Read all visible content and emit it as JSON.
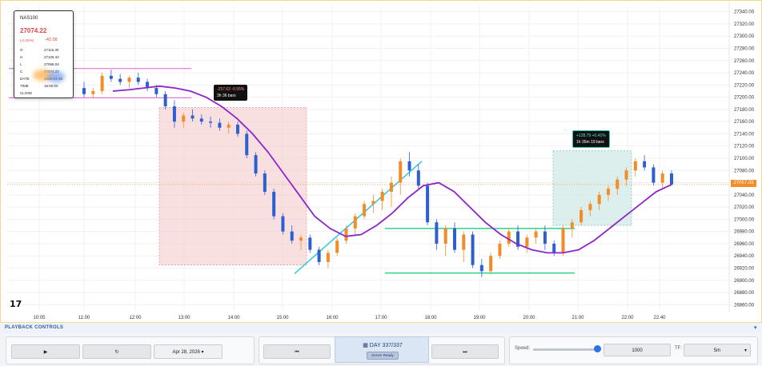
{
  "chart": {
    "symbol": "NAS100",
    "last_price": "27074.22",
    "change_pct": "(-0.16%)",
    "change_abs": "-42.08",
    "ohlc_rows": [
      {
        "k": "O",
        "v": "27116.30"
      },
      {
        "k": "H",
        "v": "27125.42"
      },
      {
        "k": "L",
        "v": "27068.04"
      },
      {
        "k": "C",
        "v": "27074.22"
      },
      {
        "k": "DATE",
        "v": "2026-04-28"
      },
      {
        "k": "TIME",
        "v": "16:50:00"
      },
      {
        "k": "CLOSE",
        "v": ""
      }
    ],
    "current_price_tag": "27057.03",
    "short_box_label": {
      "line1": "-257.63  -0.95%",
      "line2": "3h   36 bars"
    },
    "long_box_label": {
      "line1": "+128.79  +0.41%",
      "line2": "1h 35m   19 bars"
    },
    "logo_text": "17",
    "colors": {
      "up": "#f28c28",
      "down": "#2e5fd1",
      "ma": "#8e24c9",
      "trend": "#2ec6e0",
      "level": "#2ed38a",
      "short_box": "#f4c7c7",
      "long_box": "#cfe8e6",
      "range_line": "#e060d0"
    }
  },
  "chart_data": {
    "type": "candlestick",
    "x_ticks": [
      "10:05",
      "11:00",
      "12:00",
      "13:00",
      "14:00",
      "15:00",
      "16:00",
      "17:00",
      "18:00",
      "19:00",
      "20:00",
      "21:00",
      "22:00",
      "22:40"
    ],
    "y_ticks": [
      "27340.00",
      "27320.00",
      "27300.00",
      "27280.00",
      "27260.00",
      "27240.00",
      "27220.00",
      "27200.00",
      "27180.00",
      "27160.00",
      "27140.00",
      "27120.00",
      "27100.00",
      "27080.00",
      "27060.00",
      "27040.00",
      "27020.00",
      "27000.00",
      "26980.00",
      "26960.00",
      "26940.00",
      "26920.00",
      "26900.00",
      "26880.00",
      "26860.00"
    ],
    "ylim": [
      26850,
      27350
    ],
    "candles": [
      [
        27215,
        27225,
        27200,
        27205
      ],
      [
        27205,
        27215,
        27198,
        27210
      ],
      [
        27210,
        27240,
        27205,
        27235
      ],
      [
        27235,
        27245,
        27225,
        27230
      ],
      [
        27230,
        27238,
        27220,
        27225
      ],
      [
        27225,
        27235,
        27215,
        27232
      ],
      [
        27232,
        27240,
        27220,
        27225
      ],
      [
        27225,
        27230,
        27210,
        27215
      ],
      [
        27215,
        27220,
        27200,
        27205
      ],
      [
        27205,
        27210,
        27180,
        27185
      ],
      [
        27185,
        27195,
        27150,
        27160
      ],
      [
        27160,
        27175,
        27150,
        27170
      ],
      [
        27170,
        27180,
        27160,
        27165
      ],
      [
        27165,
        27172,
        27155,
        27160
      ],
      [
        27160,
        27168,
        27150,
        27158
      ],
      [
        27158,
        27165,
        27145,
        27150
      ],
      [
        27150,
        27160,
        27140,
        27155
      ],
      [
        27155,
        27160,
        27135,
        27140
      ],
      [
        27140,
        27145,
        27100,
        27105
      ],
      [
        27105,
        27110,
        27070,
        27075
      ],
      [
        27075,
        27080,
        27040,
        27045
      ],
      [
        27045,
        27050,
        27000,
        27005
      ],
      [
        27005,
        27010,
        26975,
        26980
      ],
      [
        26980,
        26990,
        26960,
        26965
      ],
      [
        26965,
        26975,
        26950,
        26970
      ],
      [
        26970,
        26975,
        26945,
        26950
      ],
      [
        26950,
        26955,
        26925,
        26930
      ],
      [
        26930,
        26950,
        26920,
        26945
      ],
      [
        26945,
        26970,
        26940,
        26965
      ],
      [
        26965,
        26990,
        26960,
        26985
      ],
      [
        26985,
        27010,
        26975,
        27005
      ],
      [
        27005,
        27030,
        27000,
        27025
      ],
      [
        27025,
        27040,
        27010,
        27030
      ],
      [
        27030,
        27050,
        27015,
        27045
      ],
      [
        27045,
        27070,
        27020,
        27060
      ],
      [
        27060,
        27100,
        27040,
        27095
      ],
      [
        27095,
        27110,
        27070,
        27080
      ],
      [
        27080,
        27090,
        27050,
        27055
      ],
      [
        27055,
        27060,
        26990,
        26995
      ],
      [
        26995,
        27000,
        26950,
        26960
      ],
      [
        26960,
        26990,
        26940,
        26985
      ],
      [
        26985,
        26995,
        26945,
        26950
      ],
      [
        26950,
        26980,
        26930,
        26975
      ],
      [
        26975,
        26980,
        26920,
        26925
      ],
      [
        26925,
        26935,
        26905,
        26915
      ],
      [
        26915,
        26945,
        26910,
        26940
      ],
      [
        26940,
        26965,
        26935,
        26960
      ],
      [
        26960,
        26985,
        26955,
        26980
      ],
      [
        26980,
        26990,
        26950,
        26955
      ],
      [
        26955,
        26975,
        26945,
        26970
      ],
      [
        26970,
        26985,
        26960,
        26980
      ],
      [
        26980,
        26990,
        26950,
        26960
      ],
      [
        26960,
        26965,
        26940,
        26945
      ],
      [
        26945,
        26990,
        26940,
        26985
      ],
      [
        26985,
        27000,
        26970,
        26995
      ],
      [
        26995,
        27020,
        26990,
        27015
      ],
      [
        27015,
        27030,
        27005,
        27025
      ],
      [
        27025,
        27045,
        27015,
        27040
      ],
      [
        27040,
        27055,
        27030,
        27050
      ],
      [
        27050,
        27070,
        27040,
        27065
      ],
      [
        27065,
        27085,
        27055,
        27080
      ],
      [
        27080,
        27100,
        27070,
        27095
      ],
      [
        27095,
        27105,
        27080,
        27085
      ],
      [
        27085,
        27090,
        27055,
        27060
      ],
      [
        27060,
        27080,
        27050,
        27075
      ],
      [
        27075,
        27080,
        27055,
        27057
      ]
    ],
    "moving_average": [
      27210,
      27212,
      27215,
      27218,
      27215,
      27210,
      27200,
      27185,
      27165,
      27140,
      27110,
      27075,
      27040,
      27005,
      26985,
      26972,
      26975,
      26990,
      27010,
      27035,
      27055,
      27060,
      27045,
      27020,
      26995,
      26975,
      26960,
      26950,
      26945,
      26945,
      26950,
      26965,
      26985,
      27005,
      27025,
      27045,
      27057
    ]
  },
  "playback": {
    "header": "PLAYBACK CONTROLS",
    "play_label": "▶",
    "reset_label": "↻",
    "date_label": "Apr 28, 2026  ▾",
    "prev_label": "⏮",
    "next_label": "⏭",
    "day_label": "DAY 337/337",
    "status_badge": "Server Ready",
    "speed_label": "Speed:",
    "speed_value": "1000",
    "tf_label": "TF:",
    "tf_value": "5m"
  }
}
